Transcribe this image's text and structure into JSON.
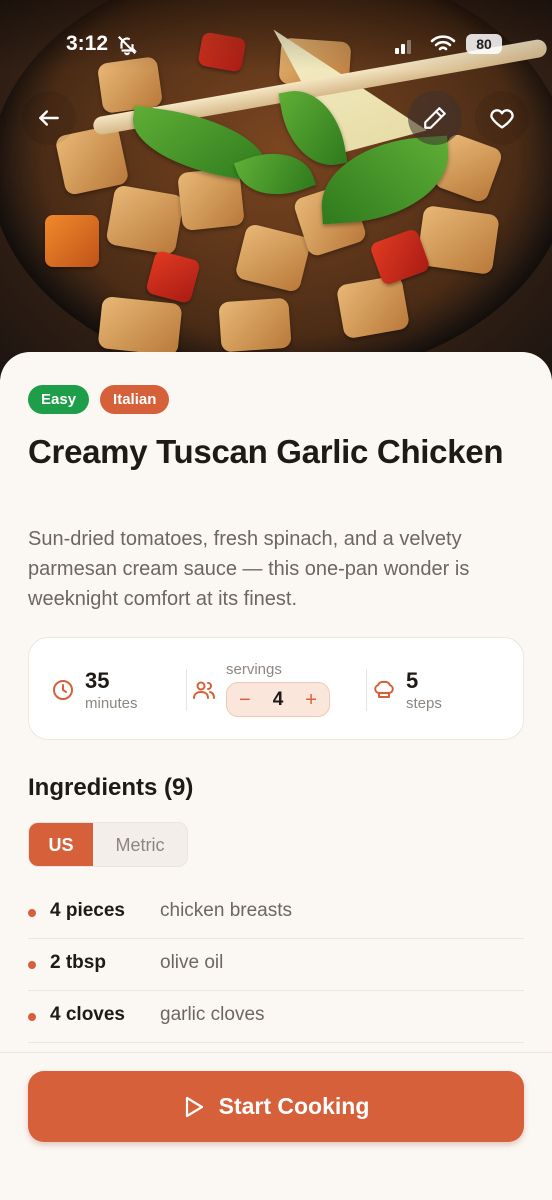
{
  "status_bar": {
    "time": "3:12",
    "battery": "80"
  },
  "recipe": {
    "tags": [
      "Easy",
      "Italian"
    ],
    "title": "Creamy Tuscan Garlic Chicken",
    "description": "Sun-dried tomatoes, fresh spinach, and a velvety parmesan cream sauce — this one-pan wonder is weeknight comfort at its finest."
  },
  "stats": {
    "time": {
      "value": "35",
      "unit": "minutes",
      "icon": "clock-icon"
    },
    "servings": {
      "label": "servings",
      "value": "4",
      "decrement": "−",
      "increment": "+",
      "icon": "people-icon"
    },
    "steps": {
      "value": "5",
      "unit": "steps",
      "icon": "chef-hat-icon"
    }
  },
  "ingredients": {
    "title": "Ingredients (9)",
    "units": {
      "us": "US",
      "metric": "Metric",
      "selected": "US"
    },
    "items": [
      {
        "qty": "4 pieces",
        "name": "chicken breasts"
      },
      {
        "qty": "2 tbsp",
        "name": "olive oil"
      },
      {
        "qty": "4 cloves",
        "name": "garlic cloves"
      }
    ]
  },
  "cta": {
    "label": "Start Cooking",
    "icon": "play-icon"
  },
  "colors": {
    "accent": "#d6603a",
    "easy": "#1f9e4a",
    "background": "#fbf7f3"
  }
}
